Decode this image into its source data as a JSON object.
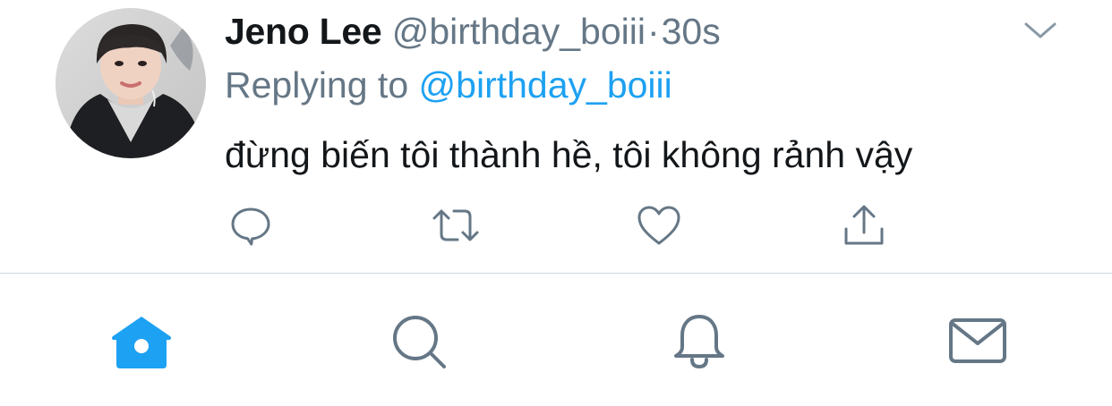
{
  "tweet": {
    "author_name": "Jeno Lee",
    "author_handle": "@birthday_boiii",
    "separator": "·",
    "timestamp": "30s",
    "reply_prefix": "Replying to",
    "reply_handle": "@birthday_boiii",
    "text": "đừng biến tôi thành hề, tôi không rảnh vậy",
    "avatar": "profile-photo",
    "menu_icon": "chevron-down-icon",
    "actions": [
      {
        "name": "reply",
        "icon": "comment-icon"
      },
      {
        "name": "retweet",
        "icon": "retweet-icon"
      },
      {
        "name": "like",
        "icon": "heart-icon"
      },
      {
        "name": "share",
        "icon": "share-icon"
      }
    ]
  },
  "tabbar": {
    "items": [
      {
        "name": "home",
        "icon": "home-icon",
        "active": true
      },
      {
        "name": "search",
        "icon": "search-icon",
        "active": false
      },
      {
        "name": "notifications",
        "icon": "bell-icon",
        "active": false
      },
      {
        "name": "messages",
        "icon": "mail-icon",
        "active": false
      }
    ]
  },
  "colors": {
    "text_primary": "#14171a",
    "text_secondary": "#657786",
    "link": "#1da1f2",
    "icon_gray": "#657786",
    "active_tab": "#1da1f2",
    "divider": "#cfd6dc",
    "background": "#ffffff"
  }
}
